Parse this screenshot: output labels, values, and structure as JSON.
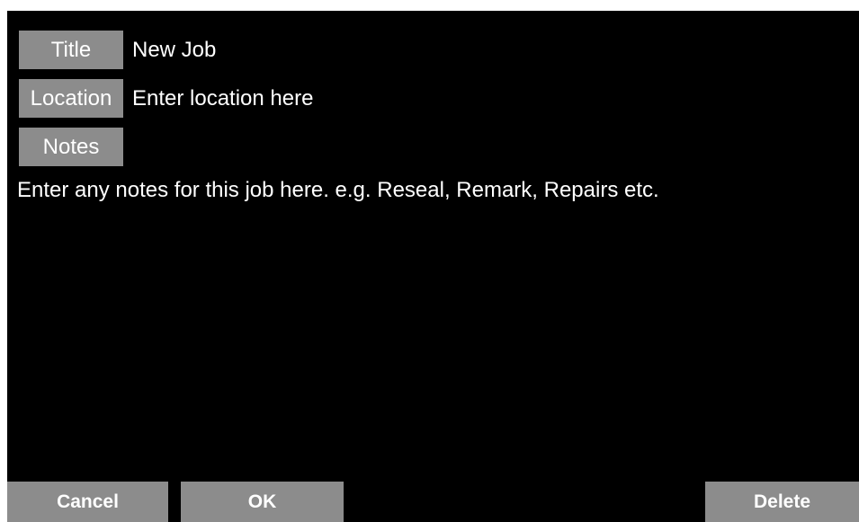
{
  "fields": {
    "title": {
      "button_label": "Title",
      "value": "New Job"
    },
    "location": {
      "button_label": "Location",
      "value": "Enter location here"
    },
    "notes": {
      "button_label": "Notes",
      "value": "Enter any notes for this job here.  e.g. Reseal, Remark, Repairs etc."
    }
  },
  "footer": {
    "cancel_label": "Cancel",
    "ok_label": "OK",
    "delete_label": "Delete"
  },
  "colors": {
    "background": "#000000",
    "button": "#8c8c8c",
    "text": "#ffffff"
  }
}
